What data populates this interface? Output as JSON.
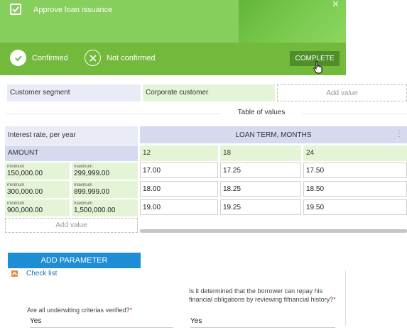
{
  "task": {
    "title": "Approve loan issuance",
    "options": [
      {
        "label": "Confirmed",
        "icon": "checkmark-icon",
        "selected": true
      },
      {
        "label": "Not confirmed",
        "icon": "x-icon",
        "selected": false
      }
    ],
    "complete_label": "COMPLETE",
    "colors": {
      "panel": "#6fbf45",
      "bottom_bar": "#73b93c",
      "button": "#4e8f2a"
    }
  },
  "segment": {
    "label": "Customer segment",
    "value": "Corporate customer",
    "add_label": "Add value"
  },
  "table": {
    "title": "Table of values",
    "row_header": "Interest rate, per year",
    "amount_header": "AMOUNT",
    "column_header": "LOAN TERM, MONTHS",
    "terms": [
      "12",
      "18",
      "24"
    ],
    "rows": [
      {
        "min_caption": "minimum",
        "min": "150,000.00",
        "max_caption": "maximum",
        "max": "299,999.00",
        "rates": [
          "17.00",
          "17.25",
          "17.50"
        ]
      },
      {
        "min_caption": "minimum",
        "min": "300,000.00",
        "max_caption": "maximum",
        "max": "899,999.00",
        "rates": [
          "18.00",
          "18.25",
          "18.50"
        ]
      },
      {
        "min_caption": "minimum",
        "min": "900,000.00",
        "max_caption": "maximum",
        "max": "1,500,000.00",
        "rates": [
          "19.00",
          "19.25",
          "19.50"
        ]
      }
    ],
    "add_value_label": "Add value"
  },
  "add_parameter_label": "ADD PARAMETER",
  "checklist": {
    "label": "Check list",
    "questions": [
      {
        "text": "Are all underwiting criterias verified?",
        "required_mark": "*",
        "answer": "Yes"
      },
      {
        "text": "Is it determined that the borrower can repay his financial obligations by reviewing fifnancial history?",
        "required_mark": "*",
        "answer": "Yes"
      }
    ]
  },
  "accent_colors": {
    "blue_button": "#1f8dd6",
    "link": "#1f6fb0",
    "toggle": "#f08a3a"
  }
}
